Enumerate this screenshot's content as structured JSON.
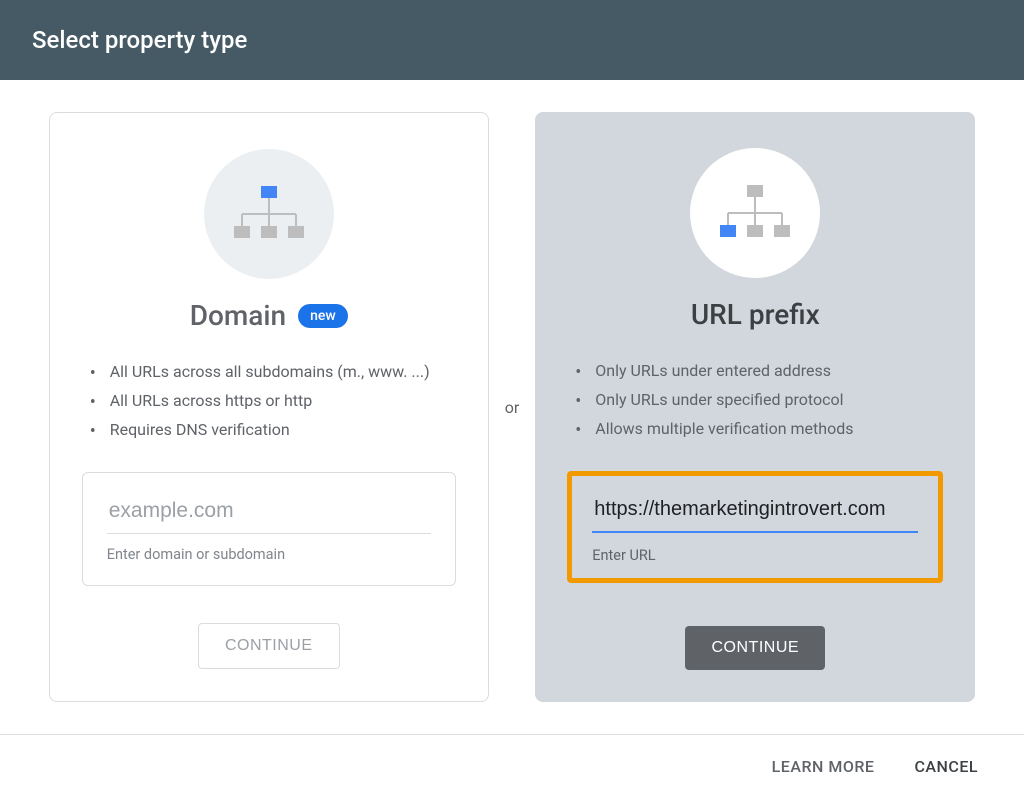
{
  "header": {
    "title": "Select property type"
  },
  "divider": "or",
  "domain_card": {
    "title": "Domain",
    "badge": "new",
    "bullets": [
      "All URLs across all subdomains (m., www. ...)",
      "All URLs across https or http",
      "Requires DNS verification"
    ],
    "input_placeholder": "example.com",
    "input_value": "",
    "input_hint": "Enter domain or subdomain",
    "continue_label": "CONTINUE"
  },
  "url_card": {
    "title": "URL prefix",
    "bullets": [
      "Only URLs under entered address",
      "Only URLs under specified protocol",
      "Allows multiple verification methods"
    ],
    "input_prefix": "https://",
    "input_value": "https://themarketingintrovert.com",
    "input_hint": "Enter URL",
    "continue_label": "CONTINUE"
  },
  "footer": {
    "learn_more": "LEARN MORE",
    "cancel": "CANCEL"
  }
}
